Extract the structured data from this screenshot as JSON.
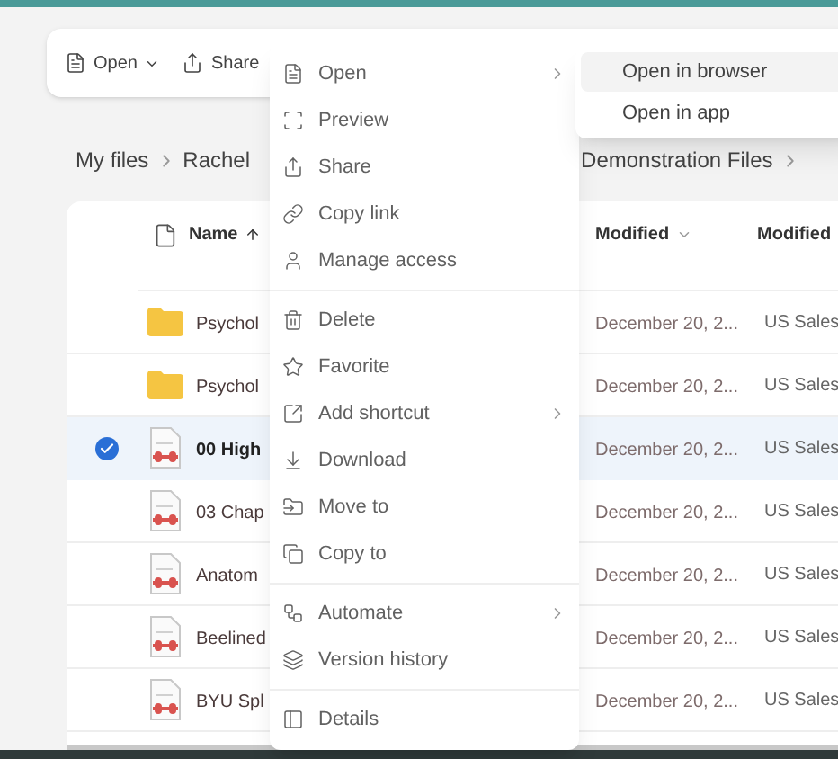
{
  "toolbar": {
    "items": [
      {
        "label": "Open",
        "dropdown": true
      },
      {
        "label": "Share",
        "dropdown": false
      }
    ]
  },
  "breadcrumb": {
    "items": [
      "My files",
      "Rachel",
      "Demonstration Files"
    ]
  },
  "table": {
    "columns": [
      {
        "label": "Name",
        "sorted": true
      },
      {
        "label": "Modified",
        "dropdown": true
      },
      {
        "label": "Modified",
        "dropdown": false
      }
    ],
    "rows": [
      {
        "kind": "folder",
        "name": "Psychol",
        "modified": "December 20, 2...",
        "modified_by": "US Sales",
        "selected": false
      },
      {
        "kind": "folder",
        "name": "Psychol",
        "modified": "December 20, 2...",
        "modified_by": "US Sales",
        "selected": false
      },
      {
        "kind": "file",
        "name": "00 High",
        "modified": "December 20, 2...",
        "modified_by": "US Sales",
        "selected": true
      },
      {
        "kind": "file",
        "name": "03 Chap",
        "modified": "December 20, 2...",
        "modified_by": "US Sales",
        "selected": false
      },
      {
        "kind": "file",
        "name": "Anatom",
        "modified": "December 20, 2...",
        "modified_by": "US Sales",
        "selected": false
      },
      {
        "kind": "file",
        "name": "Beelined",
        "modified": "December 20, 2...",
        "modified_by": "US Sales",
        "selected": false
      },
      {
        "kind": "file",
        "name": "BYU Spl",
        "modified": "December 20, 2...",
        "modified_by": "US Sales",
        "selected": false
      }
    ]
  },
  "context_menu": {
    "sections": [
      [
        {
          "label": "Open",
          "submenu": true
        },
        {
          "label": "Preview",
          "submenu": false
        },
        {
          "label": "Share",
          "submenu": false
        },
        {
          "label": "Copy link",
          "submenu": false
        },
        {
          "label": "Manage access",
          "submenu": false
        }
      ],
      [
        {
          "label": "Delete",
          "submenu": false
        },
        {
          "label": "Favorite",
          "submenu": false
        },
        {
          "label": "Add shortcut",
          "submenu": true
        },
        {
          "label": "Download",
          "submenu": false
        },
        {
          "label": "Move to",
          "submenu": false
        },
        {
          "label": "Copy to",
          "submenu": false
        }
      ],
      [
        {
          "label": "Automate",
          "submenu": true
        },
        {
          "label": "Version history",
          "submenu": false
        }
      ],
      [
        {
          "label": "Details",
          "submenu": false
        }
      ]
    ]
  },
  "submenu": {
    "items": [
      {
        "label": "Open in browser",
        "selected": true
      },
      {
        "label": "Open in app",
        "selected": false
      }
    ]
  }
}
